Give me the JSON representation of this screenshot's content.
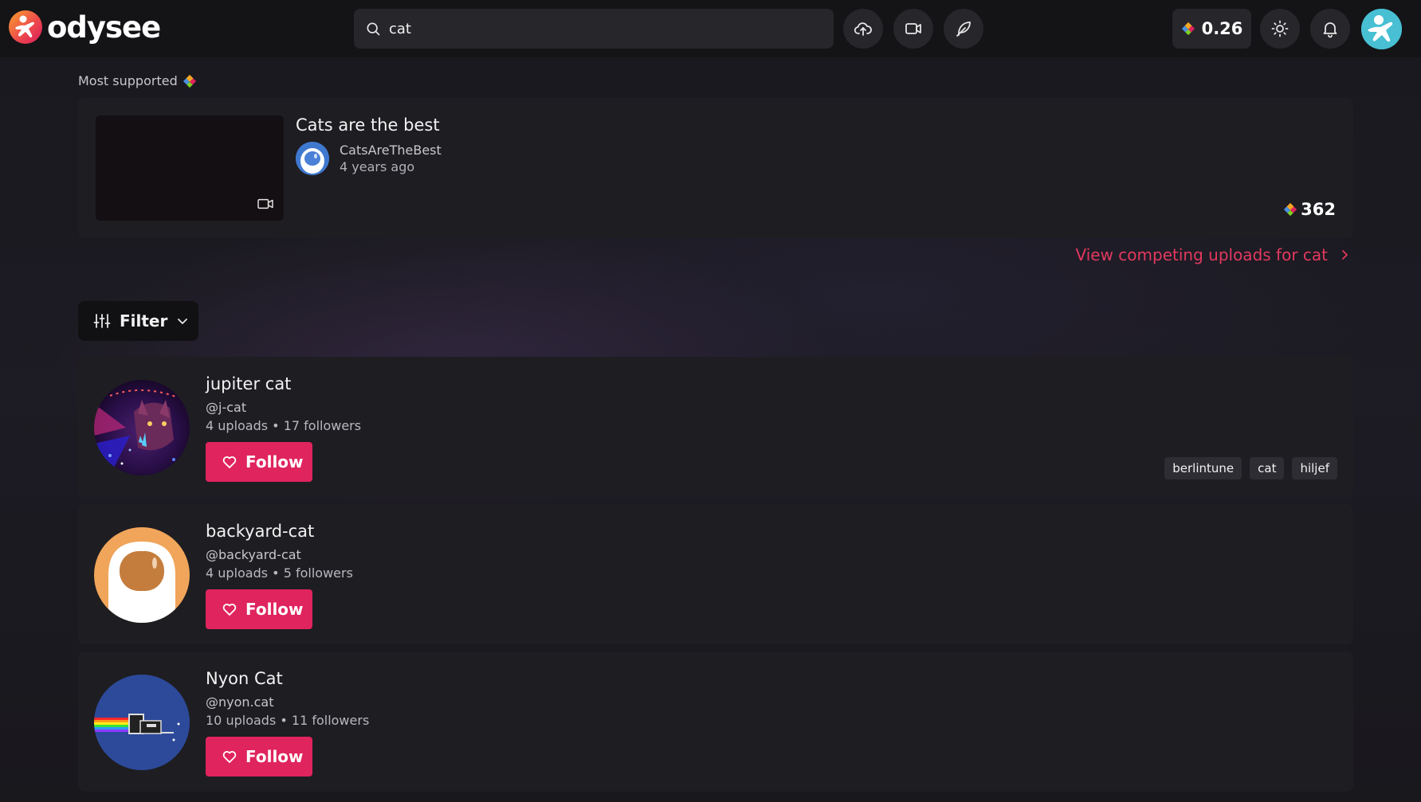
{
  "header": {
    "logo_text": "odysee",
    "search": {
      "value": "cat",
      "placeholder": ""
    },
    "credits": "0.26"
  },
  "featured": {
    "section_label": "Most supported",
    "title": "Cats are the best",
    "channel": "CatsAreTheBest",
    "time": "4 years ago",
    "support": "362",
    "competing_link": "View competing uploads for cat"
  },
  "filter": {
    "label": "Filter"
  },
  "channels": [
    {
      "name": "jupiter cat",
      "handle": "@j-cat",
      "stats": "4 uploads • 17 followers",
      "follow_label": "Follow",
      "tags": [
        "berlintune",
        "cat",
        "hiljef"
      ]
    },
    {
      "name": "backyard-cat",
      "handle": "@backyard-cat",
      "stats": "4 uploads • 5 followers",
      "follow_label": "Follow",
      "tags": []
    },
    {
      "name": "Nyon Cat",
      "handle": "@nyon.cat",
      "stats": "10 uploads • 11 followers",
      "follow_label": "Follow",
      "tags": []
    }
  ],
  "colors": {
    "accent": "#e0245e",
    "link": "#e2395e",
    "card": "#1e1d22",
    "background": "#17161b"
  },
  "icons": {
    "header": [
      "search-icon",
      "upload-icon",
      "video-icon",
      "feather-icon",
      "credits-icon",
      "sun-icon",
      "bell-icon"
    ],
    "featured": [
      "video-icon",
      "credits-icon",
      "chevron-right-icon"
    ],
    "filter": [
      "sliders-icon",
      "chevron-down-icon"
    ],
    "follow": "heart-icon"
  }
}
